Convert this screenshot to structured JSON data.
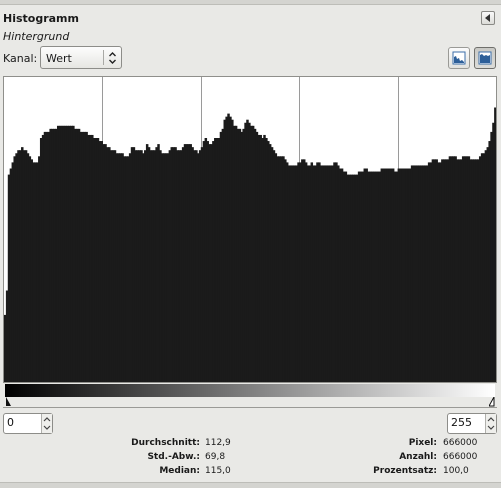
{
  "panel": {
    "title": "Histogramm",
    "subtitle": "Hintergrund"
  },
  "channel": {
    "label": "Kanal:",
    "selected": "Wert"
  },
  "range": {
    "start": "0",
    "end": "255"
  },
  "stats": {
    "mean_label": "Durchschnitt:",
    "mean": "112,9",
    "stddev_label": "Std.-Abw.:",
    "stddev": "69,8",
    "median_label": "Median:",
    "median": "115,0",
    "pixels_label": "Pixel:",
    "pixels": "666000",
    "count_label": "Anzahl:",
    "count": "666000",
    "percentile_label": "Prozentsatz:",
    "percentile": "100,0"
  },
  "icons": {
    "dock_menu": "menu-triangle-icon",
    "linear": "linear-histogram-icon",
    "log": "logarithmic-histogram-icon"
  },
  "colors": {
    "histogram_fill": "#1b1b1b",
    "panel_bg": "#e9e9e6"
  },
  "chart_data": {
    "type": "area",
    "x_range": [
      0,
      255
    ],
    "scale": "logarithmic",
    "grid_x_divisions": 5,
    "levels": [
      0.22,
      0.3,
      0.68,
      0.7,
      0.72,
      0.74,
      0.75,
      0.76,
      0.76,
      0.77,
      0.76,
      0.76,
      0.75,
      0.74,
      0.73,
      0.72,
      0.72,
      0.72,
      0.74,
      0.8,
      0.81,
      0.82,
      0.82,
      0.82,
      0.83,
      0.83,
      0.83,
      0.83,
      0.84,
      0.84,
      0.84,
      0.84,
      0.84,
      0.84,
      0.84,
      0.84,
      0.84,
      0.83,
      0.83,
      0.83,
      0.82,
      0.82,
      0.82,
      0.82,
      0.81,
      0.81,
      0.81,
      0.8,
      0.8,
      0.8,
      0.79,
      0.79,
      0.78,
      0.78,
      0.77,
      0.77,
      0.76,
      0.76,
      0.76,
      0.75,
      0.75,
      0.75,
      0.75,
      0.74,
      0.74,
      0.74,
      0.75,
      0.77,
      0.77,
      0.76,
      0.76,
      0.76,
      0.76,
      0.75,
      0.76,
      0.78,
      0.77,
      0.76,
      0.76,
      0.76,
      0.77,
      0.78,
      0.76,
      0.75,
      0.75,
      0.75,
      0.75,
      0.76,
      0.77,
      0.77,
      0.77,
      0.76,
      0.76,
      0.76,
      0.77,
      0.78,
      0.78,
      0.78,
      0.78,
      0.77,
      0.76,
      0.76,
      0.75,
      0.76,
      0.77,
      0.79,
      0.8,
      0.79,
      0.78,
      0.78,
      0.79,
      0.8,
      0.8,
      0.8,
      0.82,
      0.83,
      0.86,
      0.87,
      0.88,
      0.87,
      0.86,
      0.84,
      0.84,
      0.83,
      0.83,
      0.82,
      0.83,
      0.85,
      0.86,
      0.85,
      0.84,
      0.84,
      0.83,
      0.82,
      0.81,
      0.81,
      0.8,
      0.81,
      0.8,
      0.79,
      0.78,
      0.77,
      0.76,
      0.75,
      0.74,
      0.74,
      0.74,
      0.74,
      0.73,
      0.72,
      0.71,
      0.71,
      0.71,
      0.71,
      0.71,
      0.72,
      0.72,
      0.73,
      0.73,
      0.72,
      0.71,
      0.71,
      0.72,
      0.71,
      0.71,
      0.72,
      0.72,
      0.71,
      0.71,
      0.71,
      0.71,
      0.71,
      0.71,
      0.71,
      0.72,
      0.72,
      0.71,
      0.7,
      0.7,
      0.69,
      0.69,
      0.68,
      0.68,
      0.68,
      0.68,
      0.68,
      0.68,
      0.69,
      0.69,
      0.69,
      0.7,
      0.7,
      0.69,
      0.69,
      0.69,
      0.69,
      0.69,
      0.69,
      0.69,
      0.7,
      0.7,
      0.7,
      0.7,
      0.7,
      0.7,
      0.7,
      0.69,
      0.69,
      0.7,
      0.7,
      0.7,
      0.7,
      0.7,
      0.7,
      0.7,
      0.71,
      0.71,
      0.71,
      0.71,
      0.71,
      0.71,
      0.71,
      0.71,
      0.71,
      0.72,
      0.72,
      0.73,
      0.73,
      0.73,
      0.72,
      0.72,
      0.73,
      0.73,
      0.73,
      0.73,
      0.74,
      0.74,
      0.74,
      0.74,
      0.73,
      0.73,
      0.73,
      0.74,
      0.74,
      0.74,
      0.74,
      0.73,
      0.73,
      0.73,
      0.73,
      0.73,
      0.74,
      0.75,
      0.75,
      0.76,
      0.77,
      0.79,
      0.82,
      0.85,
      0.9
    ]
  }
}
